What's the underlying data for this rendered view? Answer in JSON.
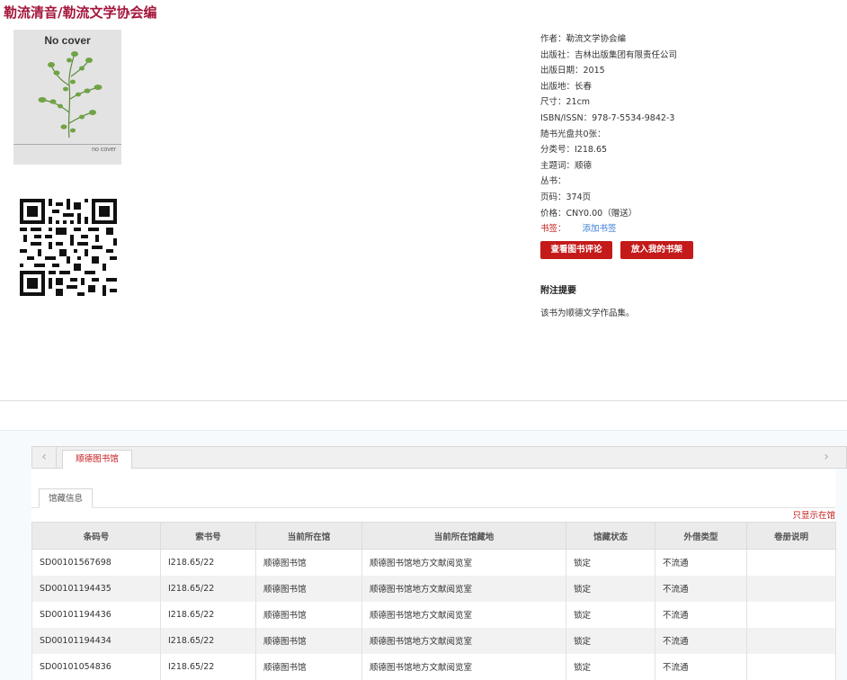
{
  "title": "勒流清音/勒流文学协会编",
  "cover": {
    "top_text": "No cover",
    "bottom_text": "no cover"
  },
  "meta": [
    "作者：勒流文学协会编",
    "出版社：吉林出版集团有限责任公司",
    "出版日期：2015",
    "出版地：长春",
    "尺寸：21cm",
    "ISBN/ISSN：978-7-5534-9842-3",
    "随书光盘共0张：",
    "分类号：I218.65",
    "主题词：顺德",
    "丛书：",
    "页码：374页",
    "价格：CNY0.00（赠送）"
  ],
  "bookmark": {
    "label": "书签：",
    "link": "添加书签"
  },
  "buttons": {
    "view_reviews": "查看图书评论",
    "add_shelf": "放入我的书架"
  },
  "abstract": {
    "title": "附注提要",
    "text": "该书为顺德文学作品集。"
  },
  "tabs": {
    "prev": "‹",
    "next": "›",
    "active": "顺德图书馆"
  },
  "holdings": {
    "subtab": "馆藏信息",
    "only_available": "只显示在馆",
    "columns": [
      "条码号",
      "索书号",
      "当前所在馆",
      "当前所在馆藏地",
      "馆藏状态",
      "外借类型",
      "卷册说明"
    ],
    "rows": [
      [
        "SD00101567698",
        "I218.65/22",
        "顺德图书馆",
        "顺德图书馆地方文献阅览室",
        "锁定",
        "不流通",
        ""
      ],
      [
        "SD00101194435",
        "I218.65/22",
        "顺德图书馆",
        "顺德图书馆地方文献阅览室",
        "锁定",
        "不流通",
        ""
      ],
      [
        "SD00101194436",
        "I218.65/22",
        "顺德图书馆",
        "顺德图书馆地方文献阅览室",
        "锁定",
        "不流通",
        ""
      ],
      [
        "SD00101194434",
        "I218.65/22",
        "顺德图书馆",
        "顺德图书馆地方文献阅览室",
        "锁定",
        "不流通",
        ""
      ],
      [
        "SD00101054836",
        "I218.65/22",
        "顺德图书馆",
        "顺德图书馆地方文献阅览室",
        "锁定",
        "不流通",
        ""
      ]
    ]
  },
  "colors": {
    "accent": "#c41a1a",
    "title": "#a4153a",
    "link": "#3a7bd5"
  },
  "icons": {
    "cover": "plant-image",
    "qr": "qr-code-icon",
    "prev": "chevron-left-icon",
    "next": "chevron-right-icon"
  }
}
